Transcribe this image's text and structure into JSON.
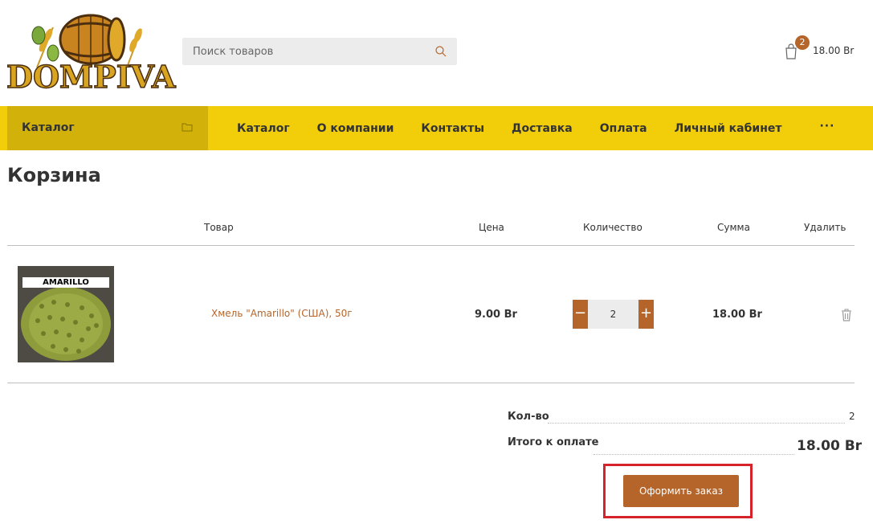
{
  "header": {
    "logo_text": "DOMPIVA",
    "search_placeholder": "Поиск товаров",
    "cart_count": "2",
    "cart_total": "18.00 Br"
  },
  "nav": {
    "catalog_button": "Каталог",
    "items": [
      "Каталог",
      "О компании",
      "Контакты",
      "Доставка",
      "Оплата",
      "Личный кабинет"
    ],
    "more": "···"
  },
  "page": {
    "title": "Корзина"
  },
  "table": {
    "headers": [
      "Товар",
      "Цена",
      "Количество",
      "Сумма",
      "Удалить"
    ],
    "rows": [
      {
        "image_label": "AMARILLO",
        "name": "Хмель \"Amarillo\" (США), 50г",
        "price": "9.00 Br",
        "quantity": "2",
        "minus": "−",
        "plus": "+",
        "sum": "18.00 Br"
      }
    ]
  },
  "totals": {
    "qty_label": "Кол-во",
    "qty_value": "2",
    "total_label": "Итого к оплате",
    "total_value": "18.00 Br"
  },
  "checkout": {
    "button_label": "Оформить заказ"
  },
  "colors": {
    "accent": "#b5652a",
    "nav_bg": "#f2cd0a",
    "catalog_bg": "#d2b10a",
    "highlight_frame": "#d6232b"
  }
}
